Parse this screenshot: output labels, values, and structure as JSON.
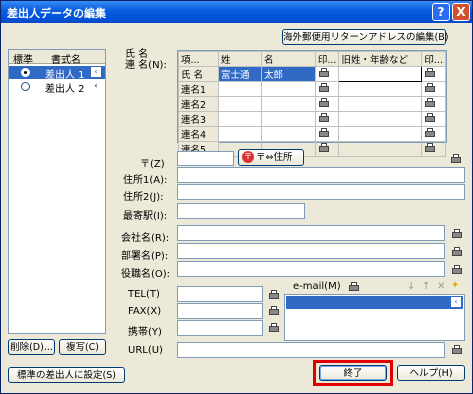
{
  "window": {
    "title": "差出人データの編集",
    "help_label": "?",
    "close_label": "X"
  },
  "list": {
    "headers": [
      "標準",
      "書式名"
    ],
    "rows": [
      {
        "name": "差出人 1"
      },
      {
        "name": "差出人 2"
      }
    ]
  },
  "left_buttons": {
    "delete": "削除(D)...",
    "copy": "複写(C)",
    "set_default": "標準の差出人に設定(S)"
  },
  "names": {
    "label_line1": "氏 名",
    "label_line2": "連 名(N):",
    "foreign_button": "海外郵便用リターンアドレスの編集(B)",
    "headers": [
      "項...",
      "姓",
      "名",
      "印...",
      "旧姓・年齢など",
      "印..."
    ],
    "rows": [
      {
        "item": "氏 名",
        "sei": "富士通",
        "mei": "太郎",
        "old": ""
      },
      {
        "item": "連名1",
        "sei": "",
        "mei": "",
        "old": ""
      },
      {
        "item": "連名2",
        "sei": "",
        "mei": "",
        "old": ""
      },
      {
        "item": "連名3",
        "sei": "",
        "mei": "",
        "old": ""
      },
      {
        "item": "連名4",
        "sei": "",
        "mei": "",
        "old": ""
      },
      {
        "item": "連名5",
        "sei": "",
        "mei": "",
        "old": ""
      }
    ]
  },
  "fields": {
    "postal": "〒(Z)",
    "postal_button": "〒⇔住所",
    "address1": "住所1(A):",
    "address2": "住所2(J):",
    "station": "最寄駅(I):",
    "company": "会社名(R):",
    "department": "部署名(P):",
    "title": "役職名(O):",
    "tel": "TEL(T)",
    "fax": "FAX(X)",
    "mobile": "携帯(Y)",
    "email": "e-mail(M)",
    "url": "URL(U)"
  },
  "bottom": {
    "close": "終了",
    "help": "ヘルプ(H)"
  },
  "colors": {
    "accent": "#316ac5",
    "highlight_border": "#e00000"
  }
}
